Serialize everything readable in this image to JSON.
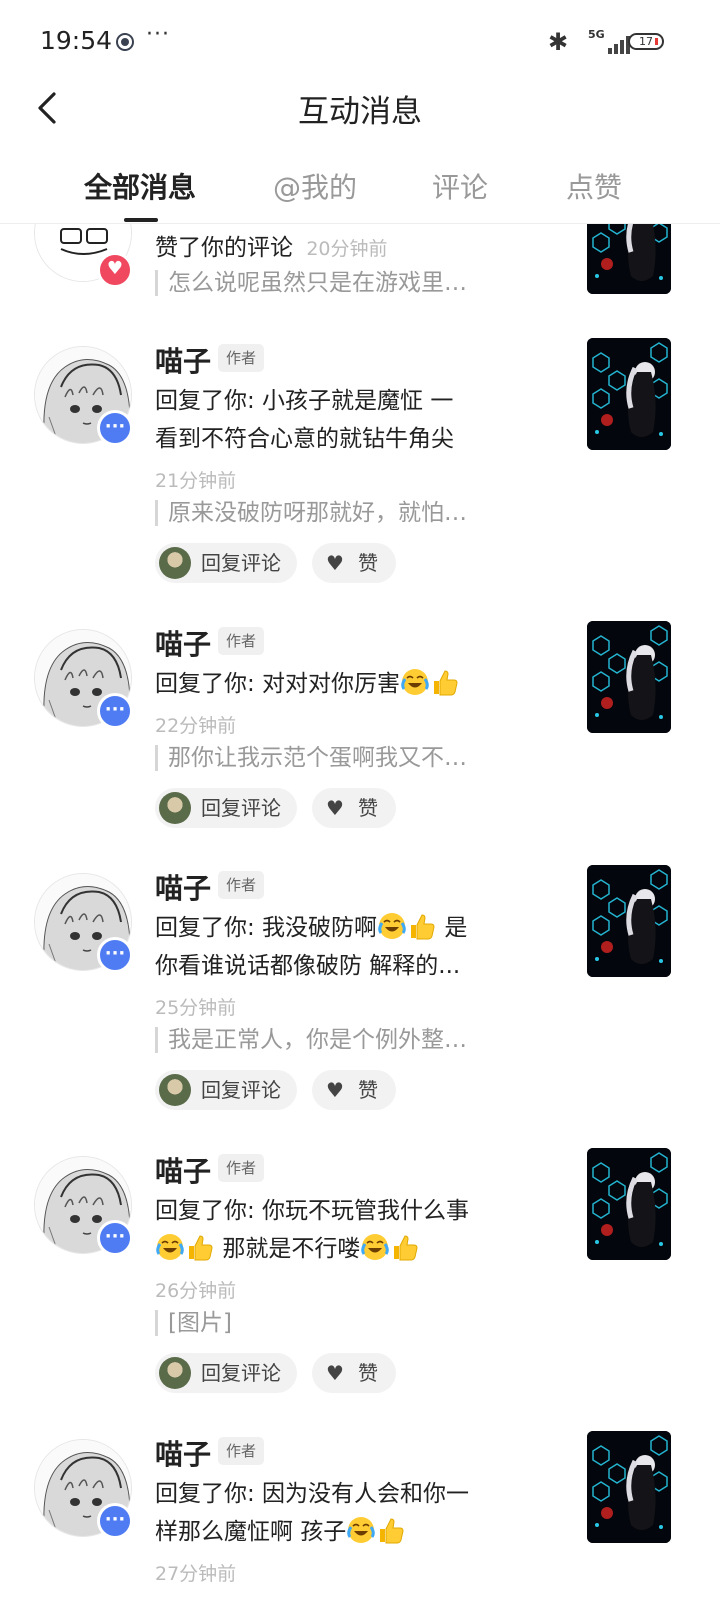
{
  "status_bar": {
    "time": "19:54",
    "dots": "···",
    "network": "5G",
    "battery": "17"
  },
  "header": {
    "title": "互动消息"
  },
  "tabs": [
    {
      "label": "全部消息",
      "active": true
    },
    {
      "label": "@我的",
      "active": false
    },
    {
      "label": "评论",
      "active": false
    },
    {
      "label": "点赞",
      "active": false
    }
  ],
  "first": {
    "action": "赞了你的评论",
    "time": "20分钟前",
    "quote": "怎么说呢虽然只是在游戏里…"
  },
  "items": [
    {
      "name": "喵子",
      "tag": "作者",
      "line1": "回复了你: 小孩子就是魔怔 一",
      "line2": "看到不符合心意的就钻牛角尖",
      "time": "21分钟前",
      "quote": "原来没破防呀那就好，就怕…",
      "reply": "回复评论",
      "like": "赞"
    },
    {
      "name": "喵子",
      "tag": "作者",
      "line1": "回复了你: 对对对你厉害",
      "line2": "",
      "time": "22分钟前",
      "quote": "那你让我示范个蛋啊我又不…",
      "reply": "回复评论",
      "like": "赞"
    },
    {
      "name": "喵子",
      "tag": "作者",
      "line1": "回复了你: 我没破防啊",
      "line1b": "是",
      "line2": "你看谁说话都像破防 解释的...",
      "time": "25分钟前",
      "quote": "我是正常人，你是个例外整…",
      "reply": "回复评论",
      "like": "赞"
    },
    {
      "name": "喵子",
      "tag": "作者",
      "line1": "回复了你: 你玩不玩管我什么事",
      "line2": "那就是不行喽",
      "time": "26分钟前",
      "quote": "[图片]",
      "reply": "回复评论",
      "like": "赞"
    },
    {
      "name": "喵子",
      "tag": "作者",
      "line1": "回复了你: 因为没有人会和你一",
      "line2": "样那么魔怔啊 孩子",
      "time": "27分钟前"
    }
  ],
  "icons": {
    "back": "back-chevron-icon",
    "chat_badge": "chat-bubble-icon",
    "like_badge": "heart-icon",
    "emoji_cry": "crying-laughing-emoji",
    "emoji_thumb": "thumbs-up-emoji"
  },
  "colors": {
    "chat_badge": "#4f7cf3",
    "like_badge": "#f0485f"
  }
}
